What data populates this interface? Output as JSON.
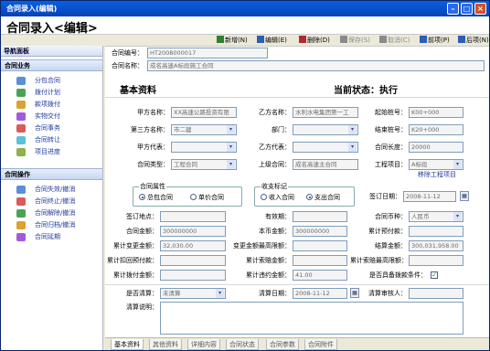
{
  "window": {
    "title": "合同录入(编辑)",
    "subtitle": "合同录入<编辑>"
  },
  "toolbar": {
    "buttons": [
      {
        "label": "新增(N)",
        "icon": "add-icon",
        "enabled": true,
        "color": "#2f7f2f"
      },
      {
        "label": "编辑(E)",
        "icon": "edit-icon",
        "enabled": true,
        "color": "#2c5fb0"
      },
      {
        "label": "删除(D)",
        "icon": "delete-icon",
        "enabled": true,
        "color": "#b02c2c"
      },
      {
        "label": "保存(S)",
        "icon": "save-icon",
        "enabled": false,
        "color": "#8a8a8a"
      },
      {
        "label": "取消(C)",
        "icon": "cancel-icon",
        "enabled": false,
        "color": "#8a8a8a"
      },
      {
        "label": "前项(P)",
        "icon": "prev-icon",
        "enabled": true,
        "color": "#2c5fb0"
      },
      {
        "label": "后项(N)",
        "icon": "next-icon",
        "enabled": true,
        "color": "#2c5fb0"
      }
    ]
  },
  "sidebar": {
    "title": "导航面板",
    "groups": [
      {
        "label": "合同业务",
        "items": [
          {
            "label": "分包合同",
            "color": "#5b8fd9"
          },
          {
            "label": "拨付计划",
            "color": "#4aa25a"
          },
          {
            "label": "款项拨付",
            "color": "#d9a232"
          },
          {
            "label": "实物交付",
            "color": "#a15bd9"
          },
          {
            "label": "合同事务",
            "color": "#d95b5b"
          },
          {
            "label": "合同转让",
            "color": "#5bc0d9"
          },
          {
            "label": "项目进度",
            "color": "#8fb04a"
          }
        ]
      },
      {
        "label": "合同操作",
        "items": [
          {
            "label": "合同失效/撤消",
            "color": "#5b8fd9"
          },
          {
            "label": "合同终止/撤消",
            "color": "#d95b5b"
          },
          {
            "label": "合同解除/撤消",
            "color": "#4aa25a"
          },
          {
            "label": "合同归档/撤消",
            "color": "#d9a232"
          },
          {
            "label": "合同延期",
            "color": "#a15bd9"
          }
        ]
      }
    ]
  },
  "form": {
    "contract_no_label": "合同编号：",
    "contract_no": "HT2008000017",
    "contract_name_label": "合同名称：",
    "contract_name": "成名高速A标段施工合同",
    "section_title": "基本资料",
    "status_label": "当前状态：",
    "status_value": "执行",
    "party_a_label": "甲方名称：",
    "party_a": "XX高速公路投资有限",
    "party_b_label": "乙方名称：",
    "party_b": "水利水电集团第一工",
    "start_chainage_label": "起始桩号：",
    "start_chainage": "K00+000",
    "third_party_label": "第三方名称：",
    "third_party": "市二建",
    "dept_label": "部门：",
    "dept": "",
    "end_chainage_label": "结束桩号：",
    "end_chainage": "K20+000",
    "party_a_rep_label": "甲方代表：",
    "party_a_rep": "",
    "party_b_rep_label": "乙方代表：",
    "party_b_rep": "",
    "contract_length_label": "合同长度：",
    "contract_length": "20000",
    "contract_type_label": "合同类型：",
    "contract_type": "工程合同",
    "parent_contract_label": "上级合同：",
    "parent_contract": "成名高速主合同",
    "project_label": "工程项目：",
    "project": "A标段",
    "remove_project_label": "移除工程项目",
    "attr_legend": "合同属性",
    "attr_options": [
      "总包合同",
      "单价合同"
    ],
    "attr_selected": 0,
    "payflag_legend": "收支标记",
    "payflag_options": [
      "收入合同",
      "支出合同"
    ],
    "payflag_selected": 1,
    "sign_date_label": "签订日期：",
    "sign_date": "2008-11-12",
    "sign_place_label": "签订地点：",
    "sign_place": "",
    "validity_label": "有效期：",
    "validity": "",
    "currency_label": "合同币种：",
    "currency": "人民币",
    "amount_label": "合同金额：",
    "amount": "300000000",
    "local_amount_label": "本币金额：",
    "local_amount": "300000000",
    "cum_prepay_label": "累计预付款：",
    "cum_prepay": "",
    "cum_change_label": "累计变更金额：",
    "cum_change": "32,030.00",
    "change_final_label": "变更金额最高限额：",
    "change_final": "",
    "settle_label": "结算金额：",
    "settle": "300,031,958.00",
    "cum_return_label": "累计扣回预付款：",
    "cum_return": "",
    "cum_claim_label": "累计索赔金额：",
    "cum_claim": "",
    "claim_cap_label": "累计索赔最高限额：",
    "claim_cap": "",
    "cum_paid_label": "累计拨付金额：",
    "cum_paid": "",
    "cum_penalty_label": "累计违约金额：",
    "cum_penalty": "41.00",
    "payable_label": "是否具备拨款条件：",
    "payable_checked": true,
    "cleared_label": "是否清算：",
    "cleared": "未清算",
    "clear_date_label": "清算日期：",
    "clear_date": "2008-11-12",
    "clear_reviewer_label": "清算审核人：",
    "clear_reviewer": "",
    "clear_note_label": "清算说明："
  },
  "tabs": {
    "items": [
      "基本资料",
      "其他资料",
      "详细内容",
      "合同状态",
      "合同参数",
      "合同附件"
    ],
    "active": 0
  }
}
